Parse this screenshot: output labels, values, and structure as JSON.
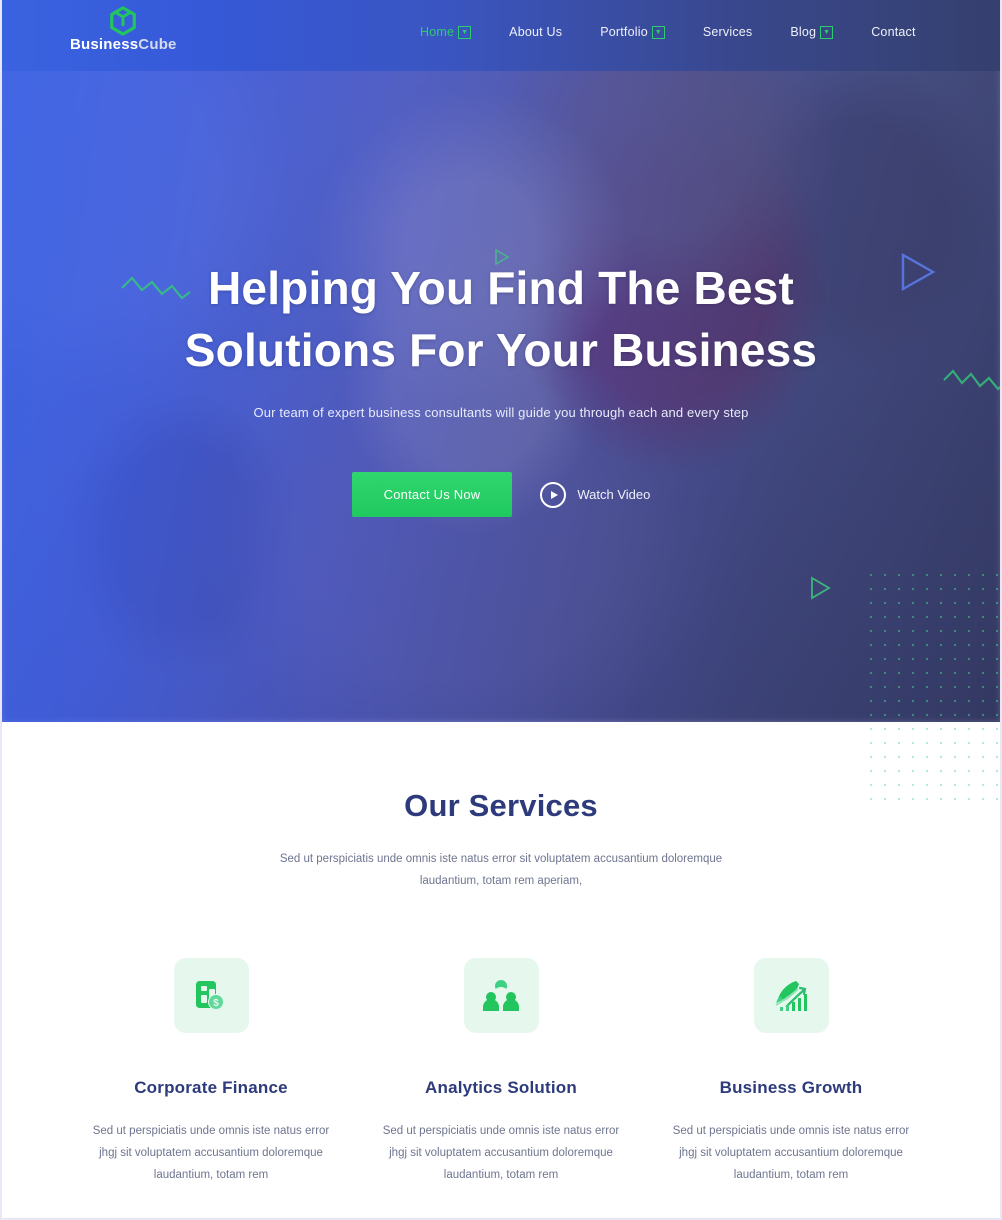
{
  "brand": {
    "name_part1": "Business",
    "name_part2": "Cube",
    "logo_icon": "cube-icon",
    "logo_color": "#22c55e"
  },
  "nav": {
    "items": [
      {
        "label": "Home",
        "has_dropdown": true,
        "active": true
      },
      {
        "label": "About Us",
        "has_dropdown": false,
        "active": false
      },
      {
        "label": "Portfolio",
        "has_dropdown": true,
        "active": false
      },
      {
        "label": "Services",
        "has_dropdown": false,
        "active": false
      },
      {
        "label": "Blog",
        "has_dropdown": true,
        "active": false
      },
      {
        "label": "Contact",
        "has_dropdown": false,
        "active": false
      }
    ]
  },
  "hero": {
    "title_line1": "Helping You Find The Best",
    "title_line2": "Solutions For Your Business",
    "subtitle": "Our team of expert business consultants will guide you through each and every step",
    "primary_button": "Contact Us Now",
    "video_link": "Watch Video",
    "video_icon": "play-circle-icon",
    "accent_color": "#22c55e",
    "overlay_color": "#3860e8"
  },
  "services": {
    "title": "Our Services",
    "subtitle_line1": "Sed ut perspiciatis unde omnis iste natus error sit voluptatem accusantium",
    "subtitle_line2": "doloremque laudantium, totam rem aperiam,",
    "cards": [
      {
        "icon": "finance-document-dollar-icon",
        "title": "Corporate Finance",
        "text_line1": "Sed ut perspiciatis unde omnis iste natus",
        "text_line2": "error jhgj sit voluptatem accusantium",
        "text_line3": "doloremque laudantium, totam rem"
      },
      {
        "icon": "people-group-icon",
        "title": "Analytics Solution",
        "text_line1": "Sed ut perspiciatis unde omnis iste natus",
        "text_line2": "error jhgj sit voluptatem accusantium",
        "text_line3": "doloremque laudantium, totam rem"
      },
      {
        "icon": "rocket-growth-chart-icon",
        "title": "Business Growth",
        "text_line1": "Sed ut perspiciatis unde omnis iste natus",
        "text_line2": "error jhgj sit voluptatem accusantium",
        "text_line3": "doloremque laudantium, totam rem"
      }
    ]
  }
}
